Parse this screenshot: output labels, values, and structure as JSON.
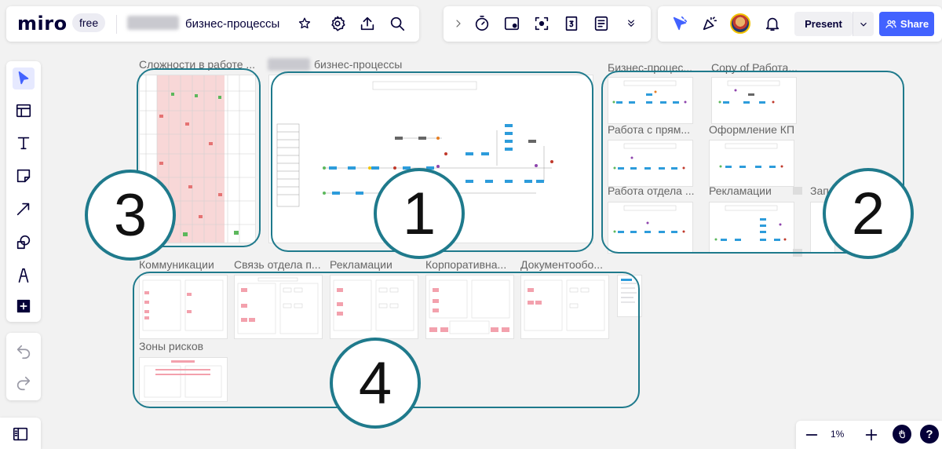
{
  "app": {
    "logo": "miro",
    "plan_badge": "free"
  },
  "board": {
    "name": "бизнес-процессы"
  },
  "toolbar_right": {
    "present_label": "Present",
    "share_label": "Share"
  },
  "zoom": {
    "value": "1%"
  },
  "frames": {
    "f3_label": "Сложности в работе ...",
    "f1_label": "бизнес-процессы",
    "r1a_label": "Бизнес-процес...",
    "r1b_label": "Copy of Работа...",
    "r2a_label": "Работа с прям...",
    "r2b_label": "Оформление КП",
    "r3a_label": "Работа отдела ...",
    "r3b_label": "Рекламации",
    "r3c_label": "Зап",
    "b1_label": "Коммуникации",
    "b2_label": "Связь отдела п...",
    "b3_label": "Рекламации",
    "b4_label": "Корпоративна...",
    "b5_label": "Документообо...",
    "b6_label": "Зоны рисков"
  },
  "callouts": {
    "c1": "1",
    "c2": "2",
    "c3": "3",
    "c4": "4"
  },
  "colors": {
    "accent": "#4262ff",
    "outline": "#1f7a8c",
    "node_blue": "#2d9cdb"
  },
  "icons": {
    "left_toolbar": [
      "select-icon",
      "templates-icon",
      "text-icon",
      "sticky-note-icon",
      "arrow-icon",
      "shapes-icon",
      "pen-icon",
      "add-more-icon",
      "undo-icon",
      "redo-icon"
    ],
    "top_center": [
      "chevron-right-icon",
      "timer-icon",
      "card-icon",
      "focus-icon",
      "calendar-icon",
      "notes-icon",
      "chevron-double-down-icon"
    ],
    "top_right": [
      "reactions-icon",
      "celebrate-icon",
      "bell-icon"
    ]
  }
}
